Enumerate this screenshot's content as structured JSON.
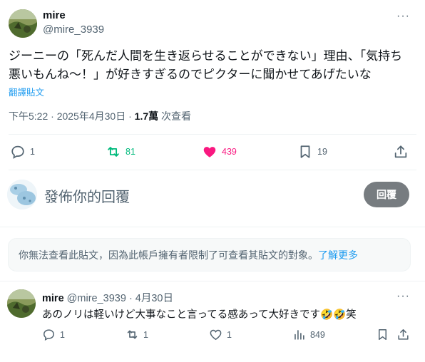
{
  "post": {
    "author_name": "mire",
    "author_handle": "@mire_3939",
    "more": "···",
    "text_line1": "ジーニーの「死んだ人間を生き返らせることができない」理由、「気持ち",
    "text_line2": "悪いもんね〜！」が好きすぎるのでピクターに聞かせてあげたいな",
    "translate_label": "翻譯貼文",
    "time": "下午5:22",
    "date": "2025年4月30日",
    "dot": "·",
    "views_count": "1.7萬",
    "views_label": " 次查看",
    "actions": {
      "reply_count": "1",
      "repost_count": "81",
      "like_count": "439",
      "bookmark_count": "19"
    }
  },
  "composer": {
    "placeholder": "發佈你的回覆",
    "reply_button": "回覆"
  },
  "notice": {
    "text": "你無法查看此貼文，因為此帳戶擁有者限制了可查看其貼文的對象。",
    "link": "了解更多"
  },
  "reply": {
    "author_name": "mire",
    "author_handle": "@mire_3939",
    "date": "· 4月30日",
    "more": "···",
    "text": "あのノリは軽いけど大事なこと言ってる感あって大好きです🤣🤣笑",
    "actions": {
      "reply_count": "1",
      "repost_count": "1",
      "like_count": "1",
      "views_count": "849"
    }
  },
  "colors": {
    "accent": "#1d9bf0",
    "repost": "#00ba7c",
    "like": "#f91880",
    "muted": "#536471"
  }
}
